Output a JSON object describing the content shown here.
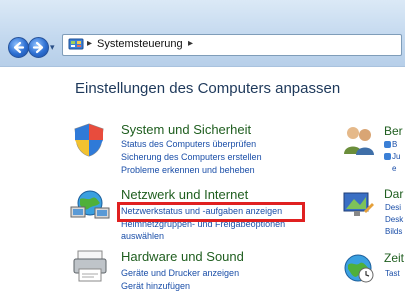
{
  "breadcrumb": {
    "location": "Systemsteuerung"
  },
  "page": {
    "title": "Einstellungen des Computers anpassen"
  },
  "categories": [
    {
      "title": "System und Sicherheit",
      "links": [
        "Status des Computers überprüfen",
        "Sicherung des Computers erstellen",
        "Probleme erkennen und beheben"
      ]
    },
    {
      "title": "Netzwerk und Internet",
      "links": [
        "Netzwerkstatus und -aufgaben anzeigen",
        "Heimnetzgruppen- und Freigabeoptionen",
        "auswählen"
      ]
    },
    {
      "title": "Hardware und Sound",
      "links": [
        "Geräte und Drucker anzeigen",
        "Gerät hinzufügen"
      ]
    }
  ],
  "right_column": [
    {
      "title": "Ber",
      "links": [
        "B",
        "Ju",
        "e"
      ]
    },
    {
      "title": "Dar",
      "links": [
        "Desi",
        "Desk",
        "Bilds"
      ]
    },
    {
      "title": "Zeit",
      "links": [
        "Tast"
      ]
    }
  ],
  "icons": {
    "back": "back-arrow-icon",
    "forward": "forward-arrow-icon",
    "control_panel": "control-panel-icon",
    "system": "shield-icon",
    "network": "network-globe-icon",
    "hardware": "printer-icon",
    "users": "users-icon",
    "appearance": "display-icon",
    "clock": "globe-clock-icon"
  },
  "colors": {
    "category_title": "#1f5e1f",
    "link": "#1a4ea8",
    "page_title": "#1e395b",
    "highlight_box": "#e02020"
  }
}
